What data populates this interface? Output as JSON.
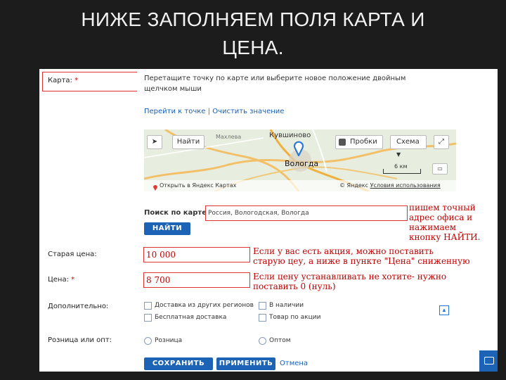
{
  "slide": {
    "title_line1": "НИЖЕ ЗАПОЛНЯЕМ ПОЛЯ КАРТА И",
    "title_line2": "ЦЕНА."
  },
  "form": {
    "map_label": "Карта:",
    "required_mark": "*",
    "map_hint_line1": "Перетащите точку по карте или выберите новое положение двойным",
    "map_hint_line2": "щелчком мыши",
    "goto_point_link": "Перейти к точке",
    "separator": "|",
    "clear_value_link": "Очистить значение",
    "map": {
      "find_button": "Найти",
      "traffic_button": "Пробки",
      "layers_button": "Схема",
      "city_main": "Вологда",
      "place_1": "Кувшиново",
      "place_2": "Махлева",
      "scale_label": "6 км",
      "open_in_yandex": "Открыть в Яндекс Картах",
      "copyright": "© Яндекс",
      "terms_link": "Условия использования"
    },
    "search_label": "Поиск по карте:",
    "search_value": "Россия, Вологодская, Вологда",
    "find_button": "НАЙТИ",
    "old_price_label": "Старая цена:",
    "old_price_value": "10 000",
    "price_label": "Цена:",
    "price_value": "8 700",
    "extra_label": "Дополнительно:",
    "extra_options": [
      "Доставка из других регионов",
      "Бесплатная доставка",
      "В наличии",
      "Товар по акции"
    ],
    "retail_label": "Розница или опт:",
    "retail_options": [
      "Розница",
      "Оптом"
    ],
    "save_button": "СОХРАНИТЬ",
    "apply_button": "ПРИМЕНИТЬ",
    "cancel_link": "Отмена"
  },
  "notes": {
    "search_note": [
      "пишем точный",
      "адрес офиса и",
      "нажимаем",
      "кнопку НАЙТИ."
    ],
    "old_price_note": [
      "Если у вас есть акция, можно поставить",
      "старую цеу, а ниже в пункте \"Цена\" сниженную"
    ],
    "price_note": [
      "Если цену устанавливать не хотите- нужно",
      "поставить 0 (нуль)"
    ]
  },
  "colors": {
    "accent": "#1c63b5",
    "note_red": "#c00000",
    "highlight": "#dd3333",
    "slide_bg": "#1c1c1c"
  }
}
